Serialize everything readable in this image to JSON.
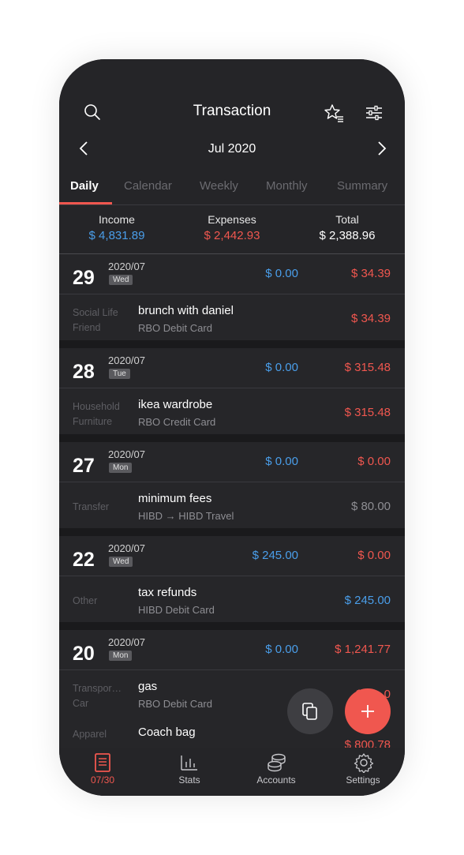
{
  "header": {
    "title": "Transaction",
    "month": "Jul 2020"
  },
  "tabs": [
    "Daily",
    "Calendar",
    "Weekly",
    "Monthly",
    "Summary"
  ],
  "summary": {
    "income_label": "Income",
    "income": "$ 4,831.89",
    "expenses_label": "Expenses",
    "expenses": "$ 2,442.93",
    "total_label": "Total",
    "total": "$ 2,388.96"
  },
  "days": [
    {
      "day": "29",
      "ym": "2020/07",
      "weekday": "Wed",
      "income": "$ 0.00",
      "expense": "$ 34.39",
      "transactions": [
        {
          "cat": "Social Life",
          "subcat": "Friend",
          "note": "brunch with daniel",
          "account": "RBO Debit Card",
          "amount": "$ 34.39",
          "type": "expense"
        }
      ]
    },
    {
      "day": "28",
      "ym": "2020/07",
      "weekday": "Tue",
      "income": "$ 0.00",
      "expense": "$ 315.48",
      "transactions": [
        {
          "cat": "Household",
          "subcat": "Furniture",
          "note": "ikea wardrobe",
          "account": "RBO Credit Card",
          "amount": "$ 315.48",
          "type": "expense"
        }
      ]
    },
    {
      "day": "27",
      "ym": "2020/07",
      "weekday": "Mon",
      "income": "$ 0.00",
      "expense": "$ 0.00",
      "transactions": [
        {
          "cat": "Transfer",
          "subcat": "",
          "note": "minimum fees",
          "account": "HIBD → HIBD Travel",
          "amount": "$ 80.00",
          "type": "transfer"
        }
      ]
    },
    {
      "day": "22",
      "ym": "2020/07",
      "weekday": "Wed",
      "income": "$ 245.00",
      "expense": "$ 0.00",
      "transactions": [
        {
          "cat": "Other",
          "subcat": "",
          "note": "tax refunds",
          "account": "HIBD Debit Card",
          "amount": "$ 245.00",
          "type": "income"
        }
      ]
    },
    {
      "day": "20",
      "ym": "2020/07",
      "weekday": "Mon",
      "income": "$ 0.00",
      "expense": "$ 1,241.77",
      "transactions": [
        {
          "cat": "Transpor…",
          "subcat": "Car",
          "note": "gas",
          "account": "RBO Debit Card",
          "amount": "$ 1…0",
          "type": "expense"
        },
        {
          "cat": "Apparel",
          "subcat": "",
          "note": "Coach bag",
          "account": "",
          "amount": "$ 800.78",
          "type": "expense"
        }
      ]
    }
  ],
  "nav": [
    {
      "label": "07/30",
      "icon": "book-icon",
      "active": true
    },
    {
      "label": "Stats",
      "icon": "stats-icon",
      "active": false
    },
    {
      "label": "Accounts",
      "icon": "coins-icon",
      "active": false
    },
    {
      "label": "Settings",
      "icon": "gear-icon",
      "active": false
    }
  ],
  "colors": {
    "accent": "#f0574f",
    "income": "#4a9eea",
    "expense": "#f0574f"
  }
}
